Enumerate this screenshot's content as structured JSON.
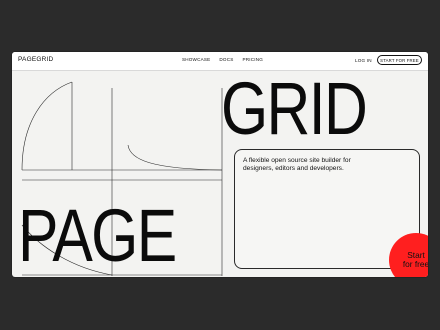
{
  "nav": {
    "brand": "PAGEGRID",
    "links": [
      "SHOWCASE",
      "DOCS",
      "PRICING"
    ],
    "login": "LOG IN",
    "cta": "START FOR FREE"
  },
  "hero": {
    "headline_top": "GRID",
    "headline_bottom": "PAGE",
    "description": "A flexible open source site builder for designers, editors and developers.",
    "cta_line1": "Start",
    "cta_line2": "for free"
  },
  "colors": {
    "background": "#2b2b2b",
    "surface": "#f3f3f1",
    "accent": "#ff1f1f",
    "text": "#0b0b0b"
  }
}
